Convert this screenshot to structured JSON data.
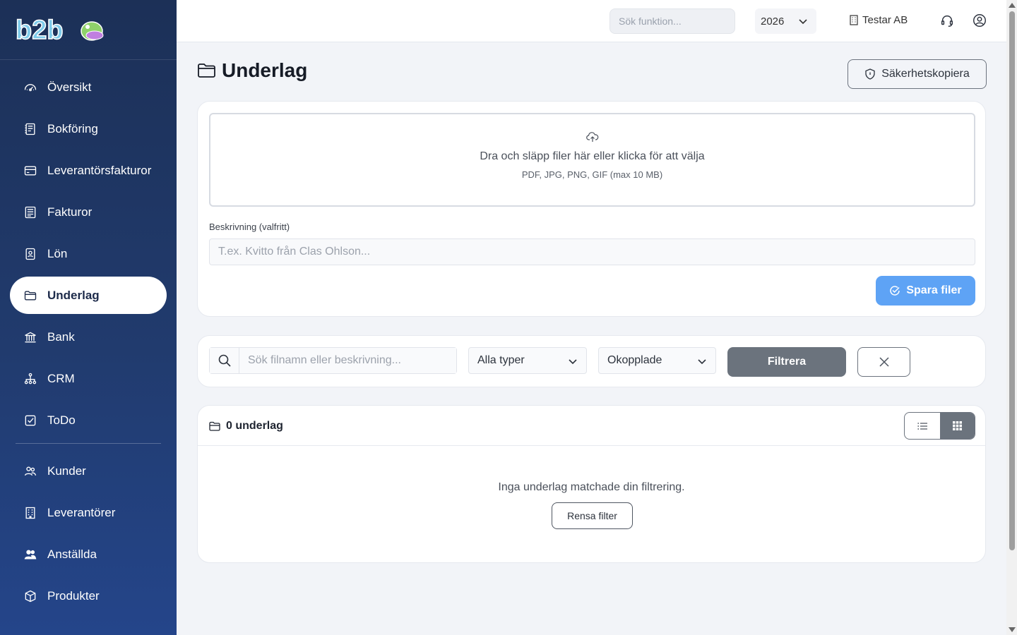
{
  "brand": {
    "logo_text": "b2b"
  },
  "sidebar": {
    "items": [
      {
        "label": "Översikt",
        "icon": "gauge-icon"
      },
      {
        "label": "Bokföring",
        "icon": "ledger-icon"
      },
      {
        "label": "Leverantörsfakturor",
        "icon": "credit-card-icon"
      },
      {
        "label": "Fakturor",
        "icon": "invoice-icon"
      },
      {
        "label": "Lön",
        "icon": "badge-icon"
      },
      {
        "label": "Underlag",
        "icon": "folder-icon",
        "active": true
      },
      {
        "label": "Bank",
        "icon": "bank-icon"
      },
      {
        "label": "CRM",
        "icon": "org-chart-icon"
      },
      {
        "label": "ToDo",
        "icon": "checkbox-icon"
      }
    ],
    "secondary_items": [
      {
        "label": "Kunder",
        "icon": "people-icon"
      },
      {
        "label": "Leverantörer",
        "icon": "building-icon"
      },
      {
        "label": "Anställda",
        "icon": "employees-icon"
      },
      {
        "label": "Produkter",
        "icon": "box-icon"
      }
    ]
  },
  "topbar": {
    "search_placeholder": "Sök funktion...",
    "year": "2026",
    "company": "Testar AB"
  },
  "page": {
    "title": "Underlag",
    "backup_label": "Säkerhetskopiera"
  },
  "upload": {
    "drop_text": "Dra och släpp filer här eller klicka för att välja",
    "formats": "PDF, JPG, PNG, GIF (max 10 MB)",
    "description_label": "Beskrivning (valfritt)",
    "description_placeholder": "T.ex. Kvitto från Clas Ohlson...",
    "save_label": "Spara filer"
  },
  "filters": {
    "search_placeholder": "Sök filnamn eller beskrivning...",
    "type_value": "Alla typer",
    "link_value": "Okopplade",
    "filter_label": "Filtrera"
  },
  "results": {
    "count_label": "0 underlag",
    "empty_text": "Inga underlag matchade din filtrering.",
    "reset_label": "Rensa filter"
  },
  "colors": {
    "sidebar": "#1c3057",
    "primary_button": "#5ea3f5",
    "filter_button": "#6b737d"
  }
}
